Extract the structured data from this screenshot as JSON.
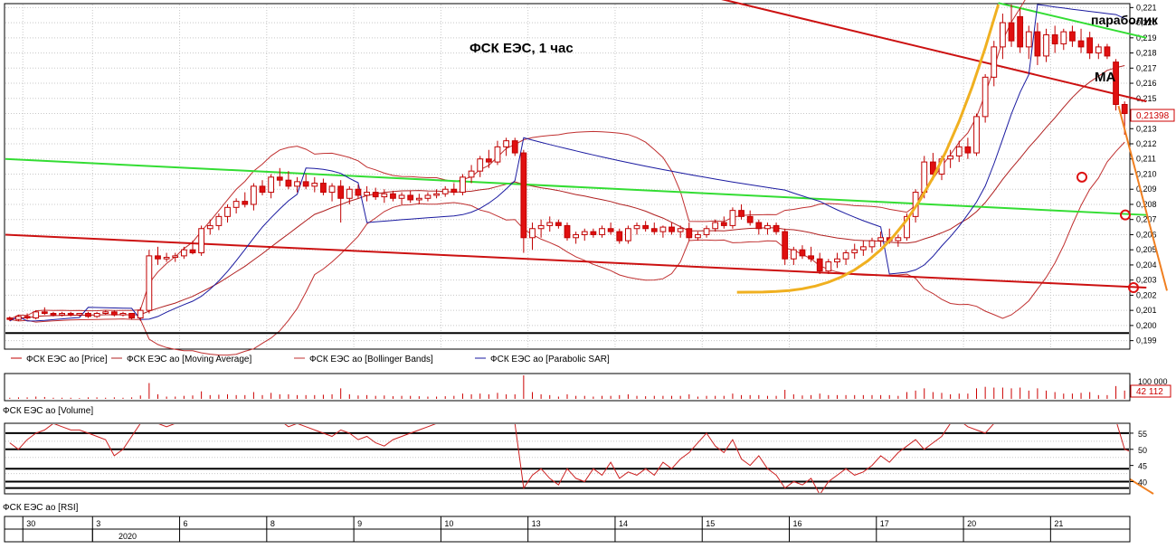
{
  "colors": {
    "candle_up": "#ffffff",
    "candle_down": "#e01010",
    "candle_outline": "#c00000",
    "moving_average": "#b02020",
    "bollinger": "#c03030",
    "parabolic_sar": "#1a1aa0",
    "channel_green": "#33dd33",
    "channel_red": "#cc1111",
    "parabola_orange": "#f0b020",
    "forecast_orange": "#f07f20",
    "support_black": "#000000",
    "grid": "#c8c8c8"
  },
  "chart_title": "ФСК ЕЭС,   1 час",
  "annotations": {
    "parabolic_label": "параболик",
    "ma_label": "MA"
  },
  "legend": [
    {
      "label": "ФСК ЕЭС ао [Price]",
      "icon": "price-line-icon"
    },
    {
      "label": "ФСК ЕЭС ао [Moving Average]",
      "icon": "ma-line-icon"
    },
    {
      "label": "ФСК ЕЭС ао [Bollinger Bands]",
      "icon": "bollinger-line-icon"
    },
    {
      "label": "ФСК ЕЭС ао [Parabolic SAR]",
      "icon": "sar-line-icon"
    }
  ],
  "price_badge": "0,21398",
  "volume_badge": "42 112",
  "volume_tick": "100 000",
  "pane_labels": {
    "volume": "ФСК ЕЭС ао [Volume]",
    "rsi": "ФСК ЕЭС ао [RSI]"
  },
  "date_axis": {
    "labels": [
      "30",
      "3",
      "6",
      "8",
      "9",
      "10",
      "13",
      "14",
      "15",
      "16",
      "17",
      "20",
      "21"
    ],
    "year": "2020"
  },
  "chart_data": [
    {
      "type": "candlestick",
      "name": "price_pane",
      "y_ticks": [
        "0,199",
        "0,200",
        "0,201",
        "0,202",
        "0,203",
        "0,204",
        "0,205",
        "0,206",
        "0,207",
        "0,208",
        "0,209",
        "0,210",
        "0,211",
        "0,212",
        "0,213",
        "0,214",
        "0,215",
        "0,216",
        "0,217",
        "0,218",
        "0,219",
        "0,220",
        "0,221"
      ],
      "ylim": [
        0.1985,
        0.2212
      ],
      "last_price": 0.21398,
      "x_label_slots": [
        2,
        10,
        20,
        30,
        40,
        50,
        60,
        70,
        80,
        90,
        100,
        110,
        120
      ],
      "candles": [
        [
          0.2005,
          0.2006,
          0.2003,
          0.2004
        ],
        [
          0.2004,
          0.2007,
          0.2003,
          0.2006
        ],
        [
          0.2006,
          0.2008,
          0.2004,
          0.2005
        ],
        [
          0.2005,
          0.201,
          0.2004,
          0.2009
        ],
        [
          0.2009,
          0.2012,
          0.2007,
          0.2008
        ],
        [
          0.2008,
          0.2009,
          0.2006,
          0.2007
        ],
        [
          0.2007,
          0.2009,
          0.2006,
          0.2008
        ],
        [
          0.2008,
          0.2009,
          0.2006,
          0.2007
        ],
        [
          0.2007,
          0.2008,
          0.2006,
          0.2008
        ],
        [
          0.2008,
          0.2009,
          0.2005,
          0.2006
        ],
        [
          0.2006,
          0.2009,
          0.2005,
          0.2008
        ],
        [
          0.2008,
          0.201,
          0.2007,
          0.2009
        ],
        [
          0.2009,
          0.201,
          0.2006,
          0.2007
        ],
        [
          0.2007,
          0.2009,
          0.2006,
          0.2008
        ],
        [
          0.2008,
          0.2008,
          0.2004,
          0.2005
        ],
        [
          0.2005,
          0.2012,
          0.2003,
          0.201
        ],
        [
          0.201,
          0.205,
          0.2008,
          0.2046
        ],
        [
          0.2046,
          0.2052,
          0.204,
          0.2044
        ],
        [
          0.2044,
          0.2048,
          0.2042,
          0.2045
        ],
        [
          0.2045,
          0.2048,
          0.2042,
          0.2046
        ],
        [
          0.2046,
          0.2052,
          0.2044,
          0.205
        ],
        [
          0.205,
          0.2056,
          0.2047,
          0.2048
        ],
        [
          0.2048,
          0.2066,
          0.2046,
          0.2064
        ],
        [
          0.2064,
          0.207,
          0.206,
          0.2066
        ],
        [
          0.2066,
          0.2074,
          0.2063,
          0.2072
        ],
        [
          0.2072,
          0.208,
          0.2068,
          0.2078
        ],
        [
          0.2078,
          0.2084,
          0.2074,
          0.2082
        ],
        [
          0.2082,
          0.2088,
          0.2078,
          0.208
        ],
        [
          0.208,
          0.2094,
          0.2076,
          0.2092
        ],
        [
          0.2092,
          0.2096,
          0.2086,
          0.2088
        ],
        [
          0.2088,
          0.21,
          0.2084,
          0.2098
        ],
        [
          0.2098,
          0.2104,
          0.2092,
          0.2096
        ],
        [
          0.2096,
          0.2102,
          0.209,
          0.2092
        ],
        [
          0.2092,
          0.2098,
          0.2088,
          0.2095
        ],
        [
          0.2095,
          0.21,
          0.209,
          0.2092
        ],
        [
          0.2092,
          0.2098,
          0.2088,
          0.2094
        ],
        [
          0.2094,
          0.2097,
          0.2086,
          0.2088
        ],
        [
          0.2088,
          0.2094,
          0.2082,
          0.2092
        ],
        [
          0.2092,
          0.2096,
          0.2068,
          0.2084
        ],
        [
          0.2084,
          0.2092,
          0.208,
          0.209
        ],
        [
          0.209,
          0.2093,
          0.2084,
          0.2086
        ],
        [
          0.2086,
          0.2092,
          0.2082,
          0.2088
        ],
        [
          0.2088,
          0.2091,
          0.2083,
          0.2085
        ],
        [
          0.2085,
          0.209,
          0.2081,
          0.2087
        ],
        [
          0.2087,
          0.2089,
          0.2082,
          0.2084
        ],
        [
          0.2084,
          0.2088,
          0.208,
          0.2086
        ],
        [
          0.2086,
          0.2089,
          0.2081,
          0.2083
        ],
        [
          0.2083,
          0.2087,
          0.208,
          0.2084
        ],
        [
          0.2084,
          0.2088,
          0.2082,
          0.2086
        ],
        [
          0.2086,
          0.209,
          0.2084,
          0.2087
        ],
        [
          0.2087,
          0.2092,
          0.2085,
          0.209
        ],
        [
          0.209,
          0.2094,
          0.2086,
          0.2088
        ],
        [
          0.2088,
          0.21,
          0.2086,
          0.2098
        ],
        [
          0.2098,
          0.2106,
          0.2094,
          0.2102
        ],
        [
          0.2102,
          0.2112,
          0.2098,
          0.211
        ],
        [
          0.211,
          0.2116,
          0.2104,
          0.2108
        ],
        [
          0.2108,
          0.2122,
          0.2106,
          0.2118
        ],
        [
          0.2118,
          0.2124,
          0.2112,
          0.2122
        ],
        [
          0.2122,
          0.2124,
          0.2112,
          0.2114
        ],
        [
          0.2114,
          0.2116,
          0.2048,
          0.2058
        ],
        [
          0.2058,
          0.2068,
          0.205,
          0.2064
        ],
        [
          0.2064,
          0.207,
          0.2058,
          0.2066
        ],
        [
          0.2066,
          0.2072,
          0.2062,
          0.2068
        ],
        [
          0.2068,
          0.207,
          0.2064,
          0.2066
        ],
        [
          0.2066,
          0.2068,
          0.2056,
          0.2058
        ],
        [
          0.2058,
          0.2062,
          0.2054,
          0.206
        ],
        [
          0.206,
          0.2064,
          0.2056,
          0.2062
        ],
        [
          0.2062,
          0.2064,
          0.2058,
          0.206
        ],
        [
          0.206,
          0.2066,
          0.2058,
          0.2064
        ],
        [
          0.2064,
          0.2068,
          0.206,
          0.2062
        ],
        [
          0.2062,
          0.2064,
          0.2054,
          0.2056
        ],
        [
          0.2056,
          0.2066,
          0.2054,
          0.2064
        ],
        [
          0.2064,
          0.2068,
          0.206,
          0.2066
        ],
        [
          0.2066,
          0.2069,
          0.2062,
          0.2064
        ],
        [
          0.2064,
          0.2068,
          0.206,
          0.2062
        ],
        [
          0.2062,
          0.2066,
          0.2058,
          0.2065
        ],
        [
          0.2065,
          0.2068,
          0.206,
          0.2062
        ],
        [
          0.2062,
          0.2066,
          0.2058,
          0.2064
        ],
        [
          0.2064,
          0.2068,
          0.2056,
          0.2058
        ],
        [
          0.2058,
          0.2062,
          0.2056,
          0.206
        ],
        [
          0.206,
          0.2066,
          0.2058,
          0.2064
        ],
        [
          0.2064,
          0.207,
          0.2062,
          0.2068
        ],
        [
          0.2068,
          0.2072,
          0.2064,
          0.2066
        ],
        [
          0.2066,
          0.2078,
          0.2064,
          0.2076
        ],
        [
          0.2076,
          0.208,
          0.207,
          0.2072
        ],
        [
          0.2072,
          0.2076,
          0.2066,
          0.2068
        ],
        [
          0.2068,
          0.207,
          0.206,
          0.2064
        ],
        [
          0.2064,
          0.2068,
          0.206,
          0.2066
        ],
        [
          0.2066,
          0.2068,
          0.206,
          0.2062
        ],
        [
          0.2062,
          0.2064,
          0.204,
          0.2044
        ],
        [
          0.2044,
          0.2052,
          0.204,
          0.205
        ],
        [
          0.205,
          0.2053,
          0.2044,
          0.2046
        ],
        [
          0.2046,
          0.2052,
          0.2042,
          0.2044
        ],
        [
          0.2044,
          0.2048,
          0.2034,
          0.2036
        ],
        [
          0.2036,
          0.2044,
          0.2034,
          0.2042
        ],
        [
          0.2042,
          0.2048,
          0.2038,
          0.2044
        ],
        [
          0.2044,
          0.205,
          0.204,
          0.2048
        ],
        [
          0.2048,
          0.2054,
          0.2044,
          0.205
        ],
        [
          0.205,
          0.2056,
          0.2046,
          0.2052
        ],
        [
          0.2052,
          0.2058,
          0.2048,
          0.2056
        ],
        [
          0.2056,
          0.2062,
          0.2052,
          0.2058
        ],
        [
          0.2058,
          0.2064,
          0.2054,
          0.2056
        ],
        [
          0.2056,
          0.206,
          0.2052,
          0.2058
        ],
        [
          0.2058,
          0.2074,
          0.2056,
          0.2072
        ],
        [
          0.2072,
          0.209,
          0.2068,
          0.2088
        ],
        [
          0.2088,
          0.2112,
          0.2084,
          0.2108
        ],
        [
          0.2108,
          0.2114,
          0.2096,
          0.21
        ],
        [
          0.21,
          0.2112,
          0.2096,
          0.211
        ],
        [
          0.211,
          0.2116,
          0.2104,
          0.2112
        ],
        [
          0.2112,
          0.2122,
          0.2108,
          0.2118
        ],
        [
          0.2118,
          0.2124,
          0.211,
          0.2114
        ],
        [
          0.2114,
          0.214,
          0.2112,
          0.2138
        ],
        [
          0.2138,
          0.2166,
          0.2134,
          0.2164
        ],
        [
          0.2164,
          0.2188,
          0.2158,
          0.2184
        ],
        [
          0.2184,
          0.2206,
          0.2176,
          0.22
        ],
        [
          0.22,
          0.2212,
          0.2184,
          0.2188
        ],
        [
          0.2204,
          0.221,
          0.218,
          0.2184
        ],
        [
          0.2184,
          0.2198,
          0.2176,
          0.2194
        ],
        [
          0.2194,
          0.22,
          0.2172,
          0.2178
        ],
        [
          0.2178,
          0.2196,
          0.2174,
          0.2192
        ],
        [
          0.2192,
          0.2198,
          0.218,
          0.2186
        ],
        [
          0.2186,
          0.2196,
          0.2182,
          0.2194
        ],
        [
          0.2194,
          0.2198,
          0.2184,
          0.2188
        ],
        [
          0.2188,
          0.2196,
          0.218,
          0.2184
        ],
        [
          0.219,
          0.2194,
          0.2176,
          0.218
        ],
        [
          0.218,
          0.2186,
          0.2176,
          0.2184
        ],
        [
          0.2184,
          0.2186,
          0.2176,
          0.2178
        ],
        [
          0.2174,
          0.2176,
          0.2142,
          0.2146
        ],
        [
          0.2146,
          0.2148,
          0.2126,
          0.214
        ]
      ]
    },
    {
      "type": "bar",
      "name": "volume_pane",
      "ylim": [
        0,
        100000
      ],
      "last_value": 42112
    },
    {
      "type": "line",
      "name": "rsi_pane",
      "y_ticks": [
        "40",
        "45",
        "50",
        "55"
      ],
      "ylim": [
        36.5,
        57.5
      ],
      "levels": [
        55,
        50,
        44,
        40,
        38
      ],
      "values": [
        52,
        50,
        53,
        55,
        56,
        58,
        57,
        56,
        56,
        55,
        54,
        53,
        48,
        50,
        54,
        58,
        60,
        58,
        57,
        58,
        59,
        60,
        59,
        61,
        62,
        63,
        62,
        61,
        62,
        60,
        58,
        59,
        57,
        58,
        57,
        56,
        55,
        54,
        56,
        55,
        53,
        54,
        52,
        51,
        53,
        54,
        55,
        56,
        57,
        58,
        59,
        60,
        61,
        60,
        62,
        61,
        60,
        59,
        58,
        38,
        42,
        44,
        41,
        39,
        44,
        41,
        40,
        44,
        42,
        46,
        41,
        43,
        42,
        44,
        42,
        46,
        44,
        47,
        49,
        52,
        55,
        51,
        49,
        53,
        47,
        45,
        48,
        44,
        42,
        38,
        40,
        39,
        41,
        36,
        40,
        42,
        44,
        42,
        43,
        45,
        48,
        46,
        49,
        51,
        53,
        50,
        52,
        54,
        58,
        59,
        57,
        56,
        55,
        58,
        60,
        61,
        62,
        63,
        63,
        62,
        61,
        60,
        60,
        61,
        62,
        61,
        60,
        59,
        50,
        49,
        49
      ]
    }
  ]
}
